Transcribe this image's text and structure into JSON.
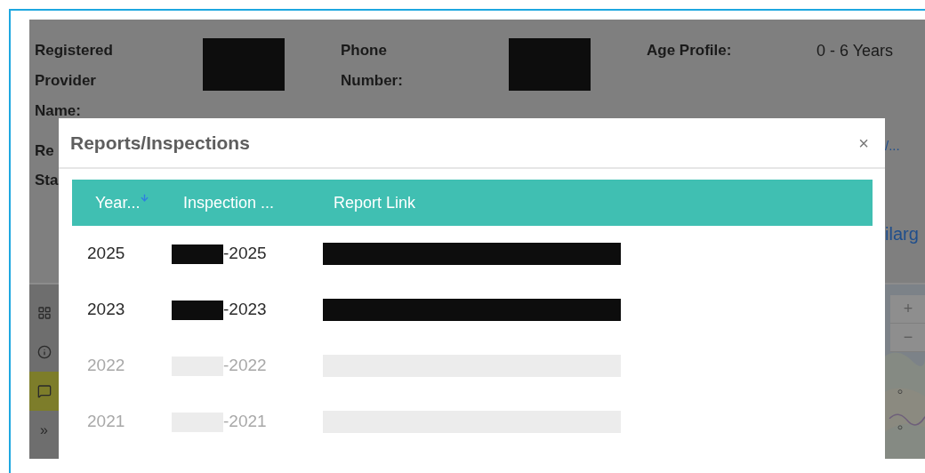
{
  "background": {
    "fields": [
      {
        "label": "Registered Provider Name:",
        "redacted": true
      },
      {
        "label": "Phone Number:",
        "redacted": true
      },
      {
        "label": "Age Profile:",
        "value": "0 - 6 Years"
      }
    ],
    "cut_labels": [
      "Re",
      "Sta"
    ],
    "cut_links": [
      "/...",
      "ilarg"
    ]
  },
  "sidebar": {
    "items": [
      {
        "kind": "grid",
        "selected": false
      },
      {
        "kind": "info",
        "selected": false
      },
      {
        "kind": "chat",
        "selected": true
      },
      {
        "kind": "text",
        "label": "»",
        "selected": false
      }
    ]
  },
  "map": {
    "zoom_buttons": [
      "+",
      "−"
    ]
  },
  "modal": {
    "title": "Reports/Inspections",
    "close": "×",
    "table": {
      "columns": [
        {
          "label": "Year...",
          "sorted": true
        },
        {
          "label": "Inspection ...",
          "sorted": false
        },
        {
          "label": "Report Link",
          "sorted": false
        }
      ],
      "rows": [
        {
          "year": "2025",
          "date": "-2025",
          "faded": false
        },
        {
          "year": "2023",
          "date": "-2023",
          "faded": false
        },
        {
          "year": "2022",
          "date": "-2022",
          "faded": true
        },
        {
          "year": "2021",
          "date": "-2021",
          "faded": true
        }
      ]
    }
  }
}
